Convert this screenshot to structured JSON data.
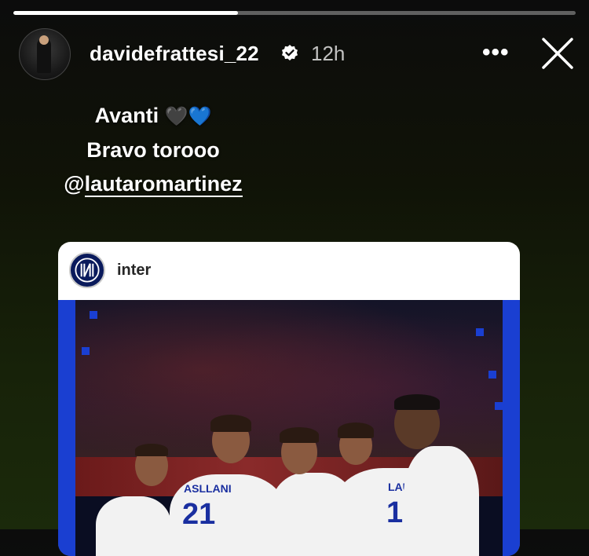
{
  "story": {
    "progress_fraction": 0.4
  },
  "header": {
    "username": "davidefrattesi_22",
    "time": "12h",
    "more_label": "•••",
    "verified_icon": "verified-badge-icon",
    "close_icon": "close-icon"
  },
  "caption": {
    "line1": "Avanti",
    "line1_emojis": "🖤💙",
    "line2": "Bravo torooo",
    "mention_prefix": "@",
    "mention_handle": "lautaromartinez"
  },
  "shared_post": {
    "account": "inter",
    "jersey_numbers": [
      "21",
      "10"
    ],
    "jersey_names": [
      "ASLLANI",
      "LAUTARO"
    ]
  },
  "colors": {
    "inter_blue": "#1a3fd1",
    "background_top": "#0c0c0c",
    "background_bottom": "#1b2a0b"
  }
}
